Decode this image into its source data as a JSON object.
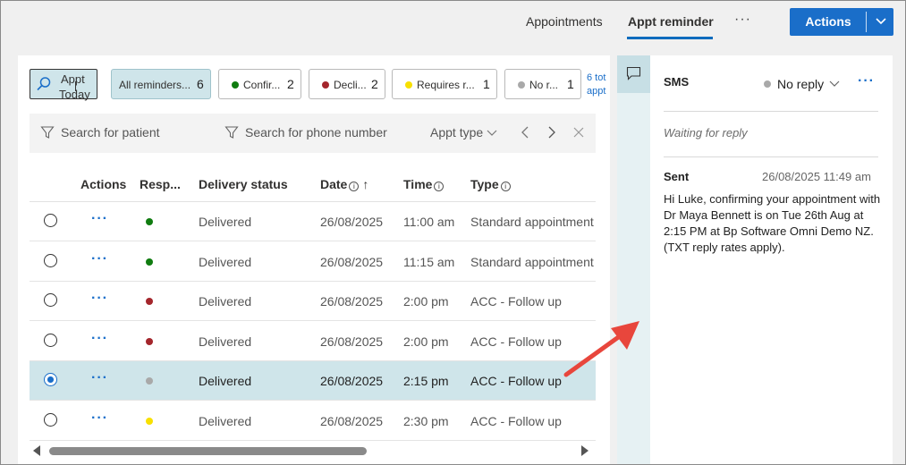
{
  "nav": {
    "tabs": [
      {
        "label": "Appointments",
        "active": false
      },
      {
        "label": "Appt reminder",
        "active": true
      }
    ],
    "more_label": "···",
    "actions_label": "Actions"
  },
  "toolbar": {
    "today_line1": "Appt",
    "today_line2": "Today",
    "chips": [
      {
        "label": "All reminders...",
        "count": "6",
        "dot_color": ""
      },
      {
        "label": "Confir...",
        "count": "2",
        "dot_color": "#107c10"
      },
      {
        "label": "Decli...",
        "count": "2",
        "dot_color": "#a4262c"
      },
      {
        "label": "Requires r...",
        "count": "1",
        "dot_color": "#f8e000"
      },
      {
        "label": "No r...",
        "count": "1",
        "dot_color": "#a9a9a9"
      }
    ],
    "total_line1": "6 tot",
    "total_line2": "appt"
  },
  "filters": {
    "patient_placeholder": "Search for patient",
    "phone_placeholder": "Search for phone number",
    "appt_type_label": "Appt type"
  },
  "table": {
    "headers": {
      "actions": "Actions",
      "response": "Resp...",
      "delivery": "Delivery status",
      "date": "Date",
      "time": "Time",
      "type": "Type"
    },
    "rows": [
      {
        "delivery": "Delivered",
        "date": "26/08/2025",
        "time": "11:00 am",
        "type": "Standard appointment",
        "dot_color": "#107c10",
        "selected": false
      },
      {
        "delivery": "Delivered",
        "date": "26/08/2025",
        "time": "11:15 am",
        "type": "Standard appointment",
        "dot_color": "#107c10",
        "selected": false
      },
      {
        "delivery": "Delivered",
        "date": "26/08/2025",
        "time": "2:00 pm",
        "type": "ACC - Follow up",
        "dot_color": "#a4262c",
        "selected": false
      },
      {
        "delivery": "Delivered",
        "date": "26/08/2025",
        "time": "2:00 pm",
        "type": "ACC - Follow up",
        "dot_color": "#a4262c",
        "selected": false
      },
      {
        "delivery": "Delivered",
        "date": "26/08/2025",
        "time": "2:15 pm",
        "type": "ACC - Follow up",
        "dot_color": "#a9a9a9",
        "selected": true
      },
      {
        "delivery": "Delivered",
        "date": "26/08/2025",
        "time": "2:30 pm",
        "type": "ACC - Follow up",
        "dot_color": "#f8e000",
        "selected": false
      }
    ]
  },
  "detail": {
    "channel": "SMS",
    "status": "No reply",
    "waiting": "Waiting for reply",
    "sent_label": "Sent",
    "sent_time": "26/08/2025 11:49 am",
    "message": "Hi Luke, confirming your appointment with Dr Maya Bennett is on Tue 26th Aug at 2:15 PM at Bp Software Omni Demo NZ. (TXT reply rates apply)."
  },
  "colors": {
    "accent": "#1a6ec9",
    "selected_row": "#cfe5ea",
    "annotation_arrow": "#e8463c"
  }
}
